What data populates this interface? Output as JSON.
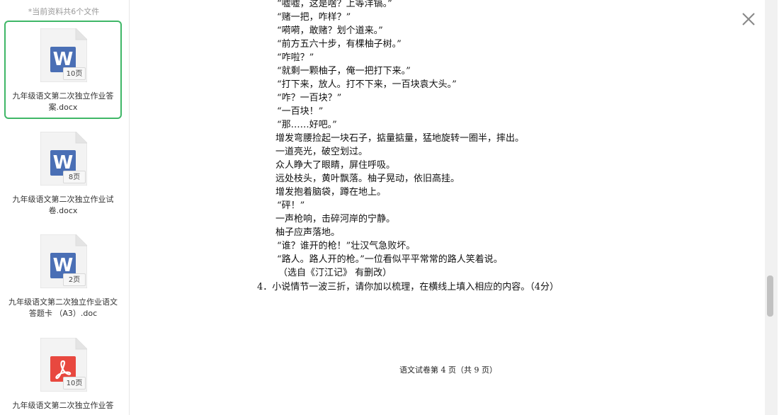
{
  "sidebar": {
    "count_text": "*当前资料共6个文件",
    "files": [
      {
        "name": "九年级语文第二次独立作业答案.docx",
        "pages": "10页",
        "type": "W",
        "color": "#4a6fb5",
        "selected": true
      },
      {
        "name": "九年级语文第二次独立作业试卷.docx",
        "pages": "8页",
        "type": "W",
        "color": "#4a6fb5",
        "selected": false
      },
      {
        "name": "九年级语文第二次独立作业语文答题卡 （A3）.doc",
        "pages": "2页",
        "type": "W",
        "color": "#4a6fb5",
        "selected": false
      },
      {
        "name": "九年级语文第二次独立作业答",
        "pages": "10页",
        "type": "pdf",
        "color": "#e8483f",
        "selected": false
      }
    ]
  },
  "document": {
    "lines": [
      "“嘘嘘，这是啥？上等洋镐。”",
      "“赌一把，咋样？”",
      "“嗬嗬，敢赌？划个道来。”",
      "“前方五六十步，有棵柚子树。”",
      "“咋啦？”",
      "“就剩一颗柚子，俺一把打下来。”",
      "“打下来，放人。打不下来，一百块袁大头。”",
      "“咋？一百块？”",
      "“一百块！”",
      "“那……好吧。”",
      "增发弯腰捡起一块石子，掂量掂量，猛地旋转一圈半，摔出。",
      "一道亮光，破空划过。",
      "众人睁大了眼睛，屏住呼吸。",
      "远处枝头，黄叶飘落。柚子晃动，依旧高挂。",
      "增发抱着脑袋，蹲在地上。",
      "“砰！”",
      "一声枪响，击碎河岸的宁静。",
      "柚子应声落地。",
      "“谁？谁开的枪！”壮汉气急败坏。",
      "“路人。路人开的枪。”一位看似平平常常的路人笑着说。",
      "（选自《汀江记》 有删改）",
      "4．小说情节一波三折，请你加以梳理，在横线上填入相应的内容。（4分）"
    ],
    "footer": "语文试卷第 4 页（共 9 页）"
  }
}
